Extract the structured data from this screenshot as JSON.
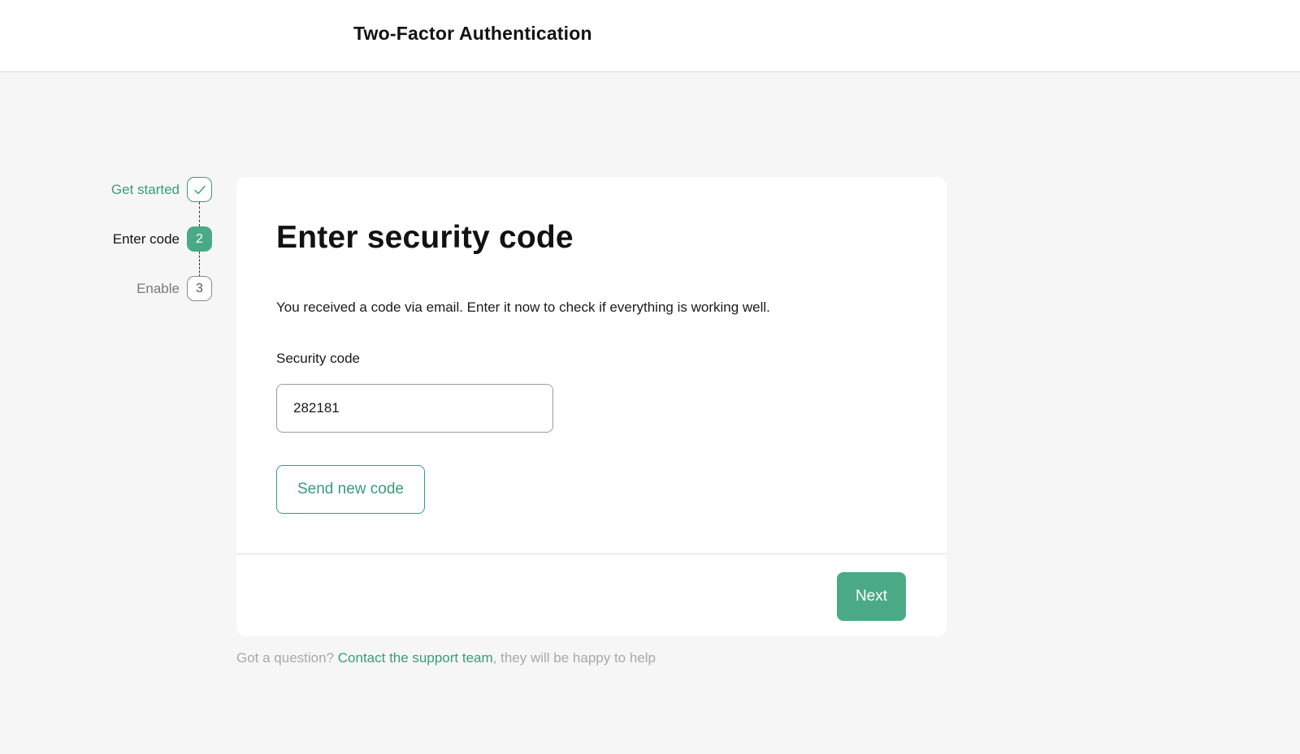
{
  "header": {
    "title": "Two-Factor Authentication"
  },
  "stepper": {
    "steps": [
      {
        "label": "Get started",
        "state": "done",
        "badge": "✓"
      },
      {
        "label": "Enter code",
        "state": "active",
        "badge": "2"
      },
      {
        "label": "Enable",
        "state": "pending",
        "badge": "3"
      }
    ]
  },
  "card": {
    "heading": "Enter security code",
    "description": "You received a code via email. Enter it now to check if everything is working well.",
    "field_label": "Security code",
    "code_value": "282181",
    "send_new_code_label": "Send new code",
    "next_label": "Next"
  },
  "help": {
    "prefix": "Got a question? ",
    "link_text": "Contact the support team",
    "suffix": ", they will be happy to help"
  },
  "colors": {
    "accent": "#4aaa85",
    "accent_text": "#3a9c78",
    "background": "#f6f6f6"
  }
}
